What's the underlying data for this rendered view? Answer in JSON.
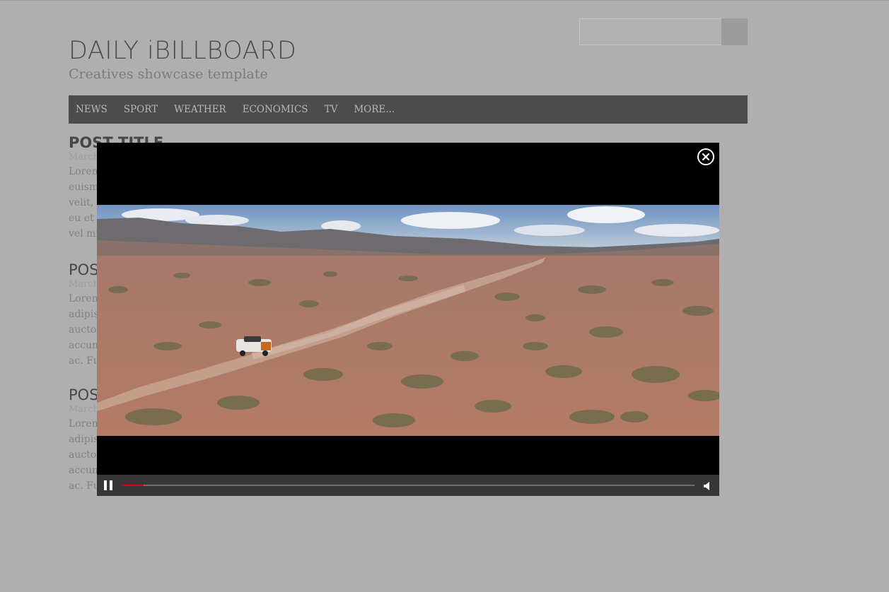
{
  "header": {
    "title": "DAILY iBILLBOARD",
    "tagline": "Creatives showcase template",
    "search": {
      "value": "",
      "placeholder": ""
    }
  },
  "nav": {
    "items": [
      {
        "label": "NEWS"
      },
      {
        "label": "SPORT"
      },
      {
        "label": "WEATHER"
      },
      {
        "label": "ECONOMICS"
      },
      {
        "label": "TV"
      },
      {
        "label": "MORE..."
      }
    ]
  },
  "posts": [
    {
      "title": "POST TITLE",
      "date": "March",
      "lines": [
        "Lorem",
        "euism",
        "velit, a",
        "eu et v",
        "vel mi"
      ]
    },
    {
      "title": "POST",
      "date": "March",
      "lines": [
        "Lorem",
        "adipis",
        "auctor",
        "accum",
        "ac. Fus"
      ]
    },
    {
      "title": "POST",
      "date": "March",
      "lines": [
        "Lorem",
        "adipis",
        "auctor",
        "accum",
        "ac. Fus"
      ]
    }
  ],
  "player": {
    "state": "playing",
    "progress_fraction": 0.038,
    "icons": {
      "close": "close-circle-icon",
      "pause": "pause-icon",
      "volume": "volume-icon"
    },
    "colors": {
      "progress": "#dd0000",
      "background": "#000000",
      "controls": "#373737"
    }
  }
}
